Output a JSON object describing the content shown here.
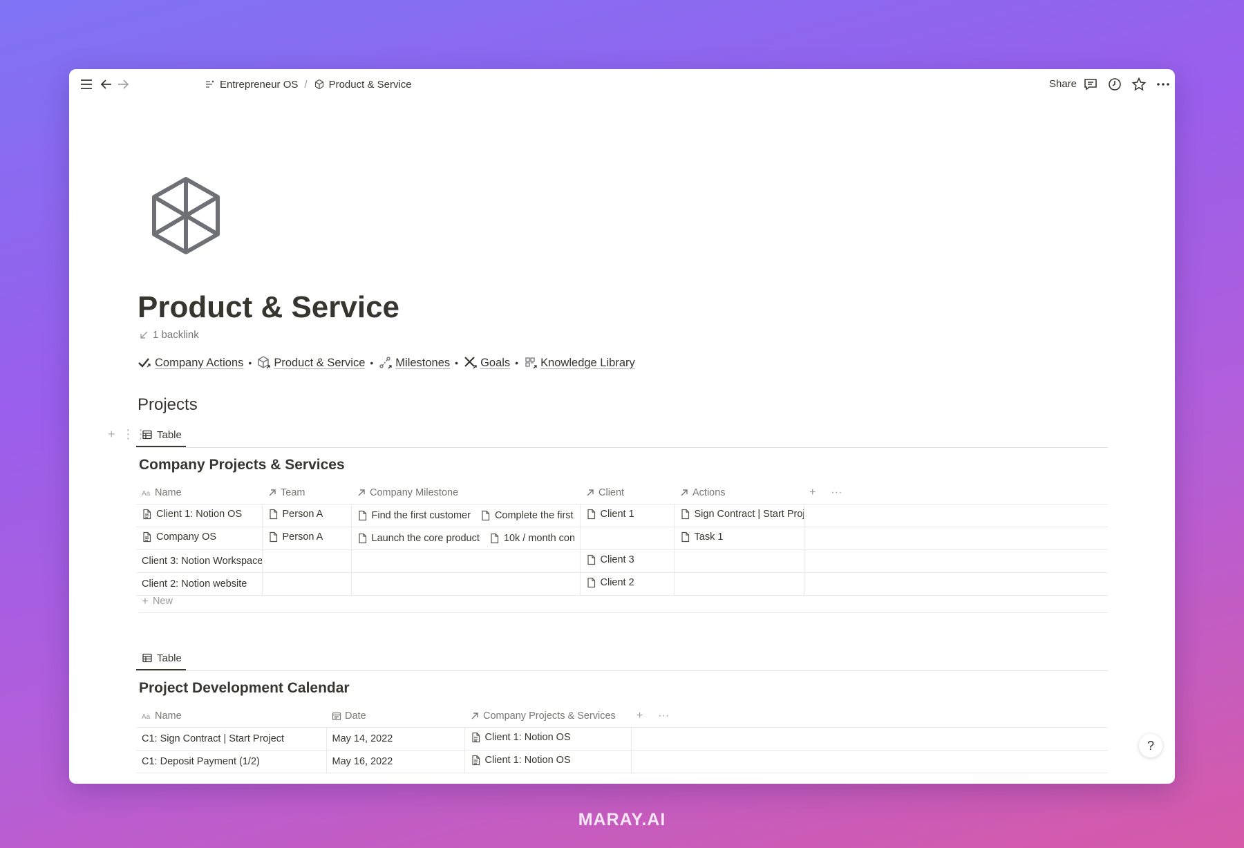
{
  "topbar": {
    "breadcrumbs": [
      "Entrepreneur OS",
      "Product & Service"
    ],
    "separator": "/",
    "share_label": "Share"
  },
  "page": {
    "title": "Product & Service",
    "backlink": "1 backlink",
    "quick_links": [
      "Company Actions",
      "Product & Service",
      "Milestones",
      "Goals",
      "Knowledge Library"
    ],
    "bullet": "•",
    "section_heading": "Projects"
  },
  "projects_db": {
    "view_tab": "Table",
    "title": "Company Projects & Services",
    "columns": [
      "Name",
      "Team",
      "Company Milestone",
      "Client",
      "Actions"
    ],
    "rows": [
      {
        "name": "Client 1: Notion OS",
        "team": "Person A",
        "milestone_1": "Find the first customer",
        "milestone_2": "Complete the first",
        "client": "Client 1",
        "actions": "Sign Contract | Start Proj"
      },
      {
        "name": "Company OS",
        "team": "Person A",
        "milestone_1": "Launch the core product",
        "milestone_2": "10k / month con:",
        "client": "",
        "actions": "Task 1"
      },
      {
        "name": "Client 3: Notion Workspace",
        "team": "",
        "milestone_1": "",
        "milestone_2": "",
        "client": "Client 3",
        "actions": ""
      },
      {
        "name": "Client 2: Notion website",
        "team": "",
        "milestone_1": "",
        "milestone_2": "",
        "client": "Client 2",
        "actions": ""
      }
    ],
    "new_label": "New"
  },
  "calendar_db": {
    "view_tab": "Table",
    "title": "Project Development Calendar",
    "columns": [
      "Name",
      "Date",
      "Company Projects & Services"
    ],
    "rows": [
      {
        "name": "C1: Sign Contract | Start Project",
        "date": "May 14, 2022",
        "project": "Client 1: Notion OS"
      },
      {
        "name": "C1: Deposit Payment (1/2)",
        "date": "May 16, 2022",
        "project": "Client 1: Notion OS"
      }
    ]
  },
  "help_label": "?",
  "brand": "MARAY.AI",
  "colors": {
    "text": "#37352f",
    "muted": "#787774",
    "border": "#e9e9e7",
    "gradient_start": "#7f73f4",
    "gradient_end": "#d65aa8"
  },
  "icons": [
    "menu-icon",
    "back-arrow-icon",
    "forward-arrow-icon",
    "workspace-icon",
    "cube-icon",
    "comment-icon",
    "clock-icon",
    "star-icon",
    "more-icon"
  ]
}
